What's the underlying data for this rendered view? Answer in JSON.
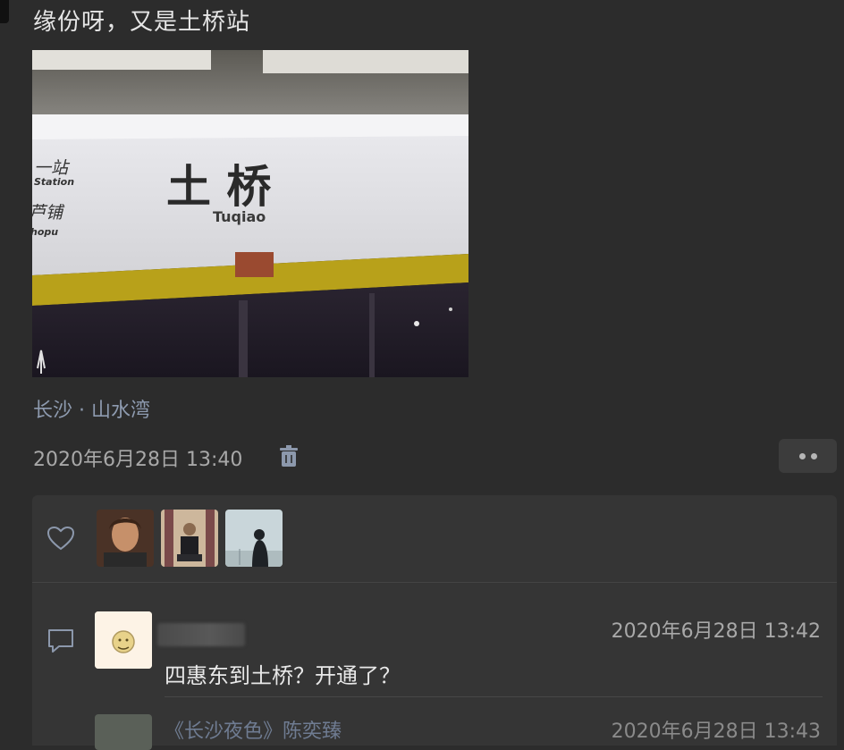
{
  "post": {
    "text": "缘份呀，又是土桥站",
    "photo": {
      "sign_main": "土 桥",
      "sign_pinyin": "Tuqiao",
      "left_text_1": "一站",
      "left_text_2": "Station",
      "left_text_3": "芦铺",
      "left_text_4": "hopu"
    },
    "location": "长沙 · 山水湾",
    "timestamp": "2020年6月28日 13:40"
  },
  "interactions": {
    "likes": [
      {
        "name": "avatar-man-1",
        "color": "#7a4a32"
      },
      {
        "name": "avatar-man-2",
        "color": "#a07a60"
      },
      {
        "name": "avatar-woman",
        "color": "#b8c8cc"
      }
    ],
    "comments": [
      {
        "time": "2020年6月28日 13:42",
        "text": "四惠东到土桥？开通了？"
      },
      {
        "text": "《长沙夜色》陈奕臻",
        "time": "2020年6月28日 13:43"
      }
    ]
  },
  "icons": {
    "trash": "trash-icon",
    "more": "more-icon",
    "like": "heart-icon",
    "comment": "comment-icon"
  },
  "colors": {
    "background": "#2c2c2c",
    "panel": "#353535",
    "link": "#8e9bb0"
  }
}
